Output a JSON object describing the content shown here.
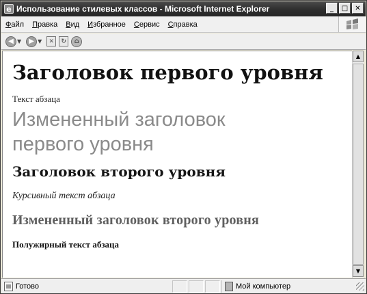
{
  "window": {
    "title": "Использование стилевых классов - Microsoft Internet Explorer"
  },
  "menu": {
    "items": [
      {
        "first": "Ф",
        "rest": "айл"
      },
      {
        "first": "П",
        "rest": "равка"
      },
      {
        "first": "В",
        "rest": "ид"
      },
      {
        "first": "И",
        "rest": "збранное"
      },
      {
        "first": "С",
        "rest": "ервис"
      },
      {
        "first": "С",
        "rest": "правка"
      }
    ]
  },
  "toolbar": {
    "icons": [
      "back-icon",
      "forward-icon",
      "stop-icon",
      "refresh-icon",
      "home-icon"
    ]
  },
  "content": {
    "heading1": "Заголовок первого уровня",
    "para": "Текст абзаца",
    "modified_heading1": "Измененный заголовок первого уровня",
    "heading2": "Заголовок второго уровня",
    "italic_para": "Курсивный текст абзаца",
    "modified_heading2": "Измененный заголовок второго уровня",
    "bold_para": "Полужирный текст абзаца"
  },
  "status": {
    "text": "Готово",
    "zone": "Мой компьютер"
  }
}
